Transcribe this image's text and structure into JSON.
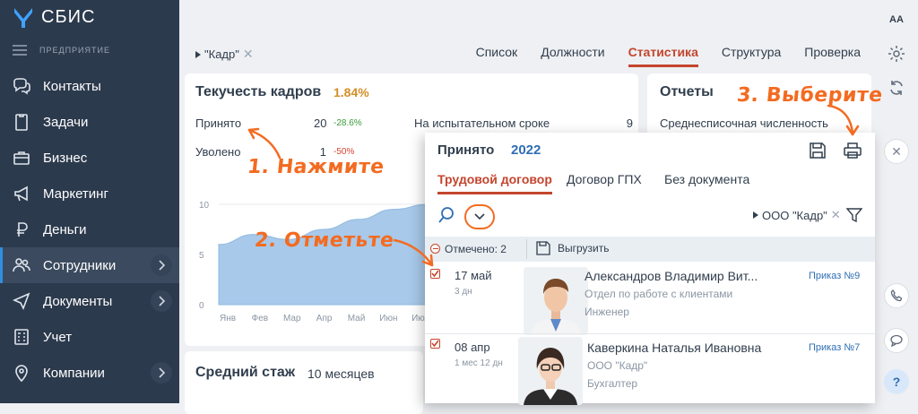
{
  "app": {
    "logo_text": "СБИС",
    "company_label": "ПРЕДПРИЯТИЕ"
  },
  "sidebar": {
    "items": [
      {
        "label": "Контакты",
        "icon": "chat-icon"
      },
      {
        "label": "Задачи",
        "icon": "clipboard-icon"
      },
      {
        "label": "Бизнес",
        "icon": "briefcase-icon"
      },
      {
        "label": "Маркетинг",
        "icon": "megaphone-icon"
      },
      {
        "label": "Деньги",
        "icon": "ruble-icon"
      },
      {
        "label": "Сотрудники",
        "icon": "people-icon",
        "active": true
      },
      {
        "label": "Документы",
        "icon": "send-icon"
      },
      {
        "label": "Учет",
        "icon": "calculator-icon"
      },
      {
        "label": "Компании",
        "icon": "location-icon"
      }
    ]
  },
  "header": {
    "filter_tag": "\"Кадр\"",
    "tabs": [
      "Список",
      "Должности",
      "Статистика",
      "Структура",
      "Проверка"
    ],
    "active_tab": "Статистика"
  },
  "turnover": {
    "title": "Текучесть кадров",
    "value": "1.84%",
    "hired_label": "Принято",
    "hired_value": "20",
    "hired_change": "-28.6%",
    "fired_label": "Уволено",
    "fired_value": "1",
    "fired_change": "-50%",
    "probation_label": "На испытательном сроке",
    "probation_value": "9",
    "chart_data": {
      "type": "area",
      "categories": [
        "Янв",
        "Фев",
        "Мар",
        "Апр",
        "Май",
        "Июн",
        "Июл"
      ],
      "values": [
        6.0,
        7.0,
        6.5,
        7.5,
        8.5,
        9.5,
        10.0
      ],
      "ylim": [
        0,
        10
      ],
      "yticks": [
        "10",
        "5",
        "0"
      ],
      "color": "#a8c9e9"
    }
  },
  "avg_tenure": {
    "title": "Средний стаж",
    "value": "10 месяцев"
  },
  "reports": {
    "title": "Отчеты",
    "item": "Среднесписочная численность"
  },
  "annotations": {
    "step1": "1. Нажмите",
    "step2": "2. Отметьте",
    "step3": "3. Выберите"
  },
  "popup": {
    "title": "Принято",
    "year": "2022",
    "tabs": [
      "Трудовой договор",
      "Договор ГПХ",
      "Без документа"
    ],
    "filter": "ООО \"Кадр\"",
    "selected_label": "Отмечено: 2",
    "export_label": "Выгрузить",
    "employees": [
      {
        "date": "17 май",
        "tenure": "3 дн",
        "name": "Александров Владимир Вит...",
        "department": "Отдел по работе с клиентами",
        "position": "Инженер",
        "order": "Приказ №9"
      },
      {
        "date": "08 апр",
        "tenure": "1 мес 12 дн",
        "name": "Каверкина Наталья Ивановна",
        "department": "ООО \"Кадр\"",
        "position": "Бухгалтер",
        "order": "Приказ №7"
      }
    ]
  },
  "colors": {
    "sidebar_bg": "#2c3a4d",
    "accent": "#c4452e",
    "link": "#2f6eb5",
    "annotation": "#f36b21"
  }
}
